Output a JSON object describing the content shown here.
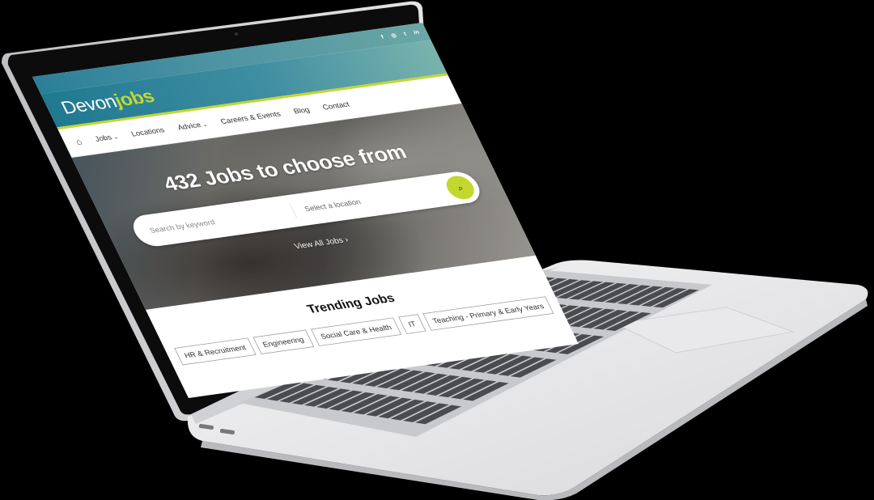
{
  "site": {
    "logo_devon": "Devon",
    "logo_jobs": "jobs",
    "accent_color": "#c2d82f",
    "brand_color": "#2a7f99"
  },
  "topbar": {
    "social_icons": [
      "facebook-icon",
      "instagram-icon",
      "twitter-icon",
      "linkedin-icon"
    ]
  },
  "nav": {
    "home_icon": "home-icon",
    "items": [
      {
        "label": "Jobs",
        "has_dropdown": true
      },
      {
        "label": "Locations",
        "has_dropdown": false
      },
      {
        "label": "Advice",
        "has_dropdown": true
      },
      {
        "label": "Careers & Events",
        "has_dropdown": false
      },
      {
        "label": "Blog",
        "has_dropdown": false
      },
      {
        "label": "Contact",
        "has_dropdown": false
      }
    ]
  },
  "hero": {
    "headline": "432 Jobs to choose from",
    "keyword_placeholder": "Search by keyword",
    "location_placeholder": "Select a location",
    "view_all": "View All Jobs"
  },
  "trending": {
    "title": "Trending Jobs",
    "tags": [
      "HR & Recruitment",
      "Engineering",
      "Social Care & Health",
      "IT",
      "Teaching - Primary & Early Years"
    ]
  }
}
